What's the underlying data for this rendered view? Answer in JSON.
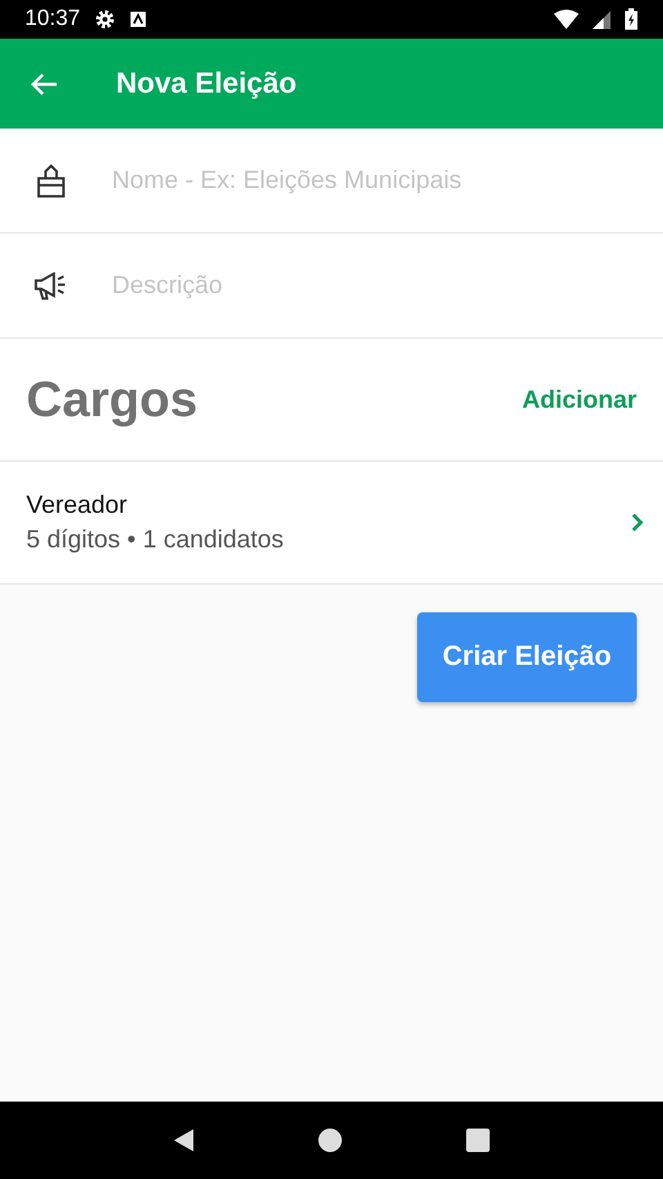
{
  "status_bar": {
    "time": "10:37"
  },
  "app_bar": {
    "title": "Nova Eleição"
  },
  "fields": [
    {
      "kind": "ballot",
      "placeholder": "Nome - Ex: Eleições Municipais"
    },
    {
      "kind": "megaphone",
      "placeholder": "Descrição"
    }
  ],
  "section": {
    "title": "Cargos",
    "action": "Adicionar"
  },
  "cargos": [
    {
      "name": "Vereador",
      "detail": "5 dígitos • 1 candidatos"
    }
  ],
  "primary_button": "Criar Eleição"
}
